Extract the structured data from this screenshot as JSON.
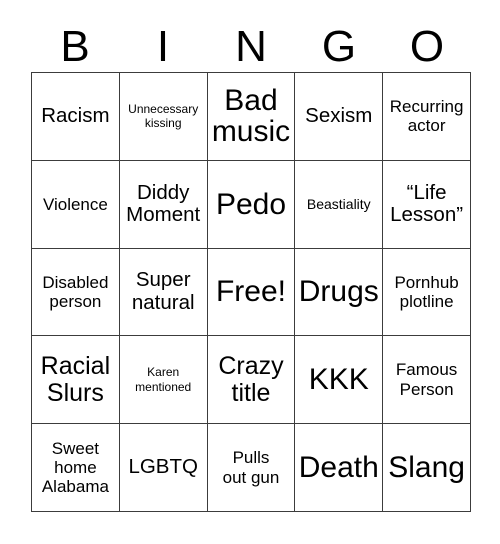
{
  "card": {
    "title": "BINGO",
    "header_letters": [
      "B",
      "I",
      "N",
      "G",
      "O"
    ],
    "colors": {
      "background": "#ffffff",
      "text": "#000000",
      "grid_line": "#3c3c3c"
    },
    "grid": {
      "columns": 5,
      "rows": 5,
      "free_space_index": 12
    },
    "cells": [
      {
        "text": "Racism",
        "size": "lg"
      },
      {
        "text": "Unnecessary\nkissing",
        "size": "xs"
      },
      {
        "text": "Bad\nmusic",
        "size": "xxl"
      },
      {
        "text": "Sexism",
        "size": "lg"
      },
      {
        "text": "Recurring\nactor",
        "size": "md"
      },
      {
        "text": "Violence",
        "size": "md"
      },
      {
        "text": "Diddy\nMoment",
        "size": "lg"
      },
      {
        "text": "Pedo",
        "size": "xxl"
      },
      {
        "text": "Beastiality",
        "size": "sm"
      },
      {
        "text": "“Life\nLesson”",
        "size": "lg"
      },
      {
        "text": "Disabled\nperson",
        "size": "md"
      },
      {
        "text": "Super\nnatural",
        "size": "lg"
      },
      {
        "text": "Free!",
        "size": "xxl"
      },
      {
        "text": "Drugs",
        "size": "xxl"
      },
      {
        "text": "Pornhub\nplotline",
        "size": "md"
      },
      {
        "text": "Racial\nSlurs",
        "size": "xl"
      },
      {
        "text": "Karen\nmentioned",
        "size": "xs"
      },
      {
        "text": "Crazy\ntitle",
        "size": "xl"
      },
      {
        "text": "KKK",
        "size": "xxl"
      },
      {
        "text": "Famous\nPerson",
        "size": "md"
      },
      {
        "text": "Sweet\nhome\nAlabama",
        "size": "md"
      },
      {
        "text": "LGBTQ",
        "size": "lg"
      },
      {
        "text": "Pulls\nout gun",
        "size": "md"
      },
      {
        "text": "Death",
        "size": "xxl"
      },
      {
        "text": "Slang",
        "size": "xxl"
      }
    ]
  }
}
